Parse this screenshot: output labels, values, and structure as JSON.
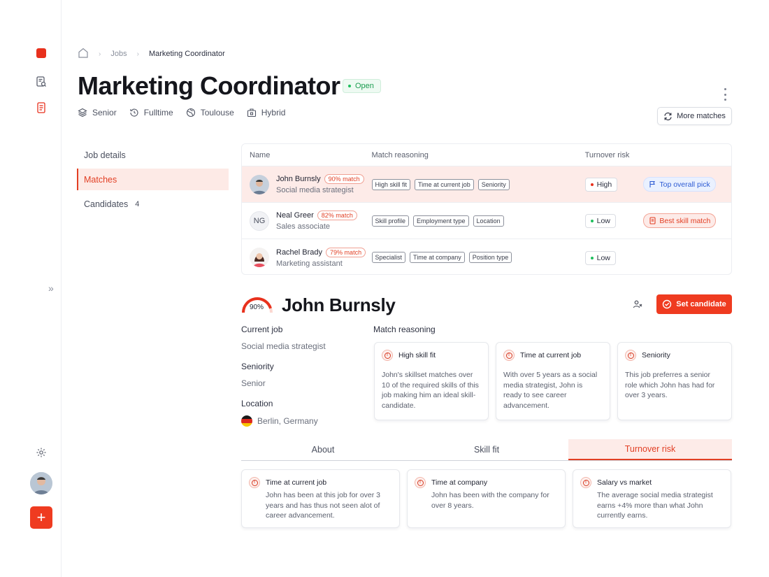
{
  "breadcrumb": {
    "level1": "Jobs",
    "current": "Marketing Coordinator"
  },
  "job": {
    "title": "Marketing Coordinator",
    "status": "Open",
    "meta": {
      "seniority": "Senior",
      "type": "Fulltime",
      "location": "Toulouse",
      "mode": "Hybrid"
    }
  },
  "actions": {
    "more_matches": "More matches",
    "set_candidate": "Set candidate"
  },
  "nav": {
    "job_details": "Job details",
    "matches": "Matches",
    "candidates": "Candidates",
    "candidates_count": "4"
  },
  "table": {
    "headers": {
      "name": "Name",
      "reasoning": "Match reasoning",
      "risk": "Turnover risk"
    },
    "rows": [
      {
        "name": "John Burnsly",
        "match": "90% match",
        "role": "Social media strategist",
        "reasons": [
          "High skill fit",
          "Time at current job",
          "Seniority"
        ],
        "risk": "High",
        "risk_color": "#e8311d",
        "tag": "Top overall pick"
      },
      {
        "name": "Neal Greer",
        "initials": "NG",
        "match": "82% match",
        "role": "Sales associate",
        "reasons": [
          "Skill profile",
          "Employment type",
          "Location"
        ],
        "risk": "Low",
        "risk_color": "#1fbf5e",
        "tag": "Best skill match"
      },
      {
        "name": "Rachel Brady",
        "match": "79% match",
        "role": "Marketing assistant",
        "reasons": [
          "Specialist",
          "Time at company",
          "Position type"
        ],
        "risk": "Low",
        "risk_color": "#1fbf5e",
        "tag": ""
      }
    ]
  },
  "candidate": {
    "score": "90%",
    "score_fraction": 0.9,
    "name": "John Burnsly",
    "current_job_label": "Current job",
    "current_job": "Social media strategist",
    "seniority_label": "Seniority",
    "seniority": "Senior",
    "location_label": "Location",
    "location": "Berlin, Germany",
    "match_reasoning_label": "Match reasoning",
    "reasons": [
      {
        "title": "High skill fit",
        "body": "John's skillset matches over 10 of the required skills of this job making him an ideal skill-candidate."
      },
      {
        "title": "Time at current job",
        "body": "With over 5 years as a social media strategist, John is ready to see career advancement."
      },
      {
        "title": "Seniority",
        "body": "This job preferres a senior role which John has had for over 3 years."
      }
    ]
  },
  "tabs": [
    "About",
    "Skill fit",
    "Turnover risk"
  ],
  "turnover_cards": [
    {
      "title": "Time at current job",
      "body": "John has been at this job for over 3 years and has thus not seen alot of career advancement."
    },
    {
      "title": "Time at company",
      "body": "John has been with the company for over 8 years."
    },
    {
      "title": "Salary vs market",
      "body": "The average social media strategist earns +4% more than what John currently earns."
    }
  ],
  "colors": {
    "accent": "#ef3b20",
    "open_green": "#1b9c50",
    "blue_tag": "#2d5bd3"
  }
}
